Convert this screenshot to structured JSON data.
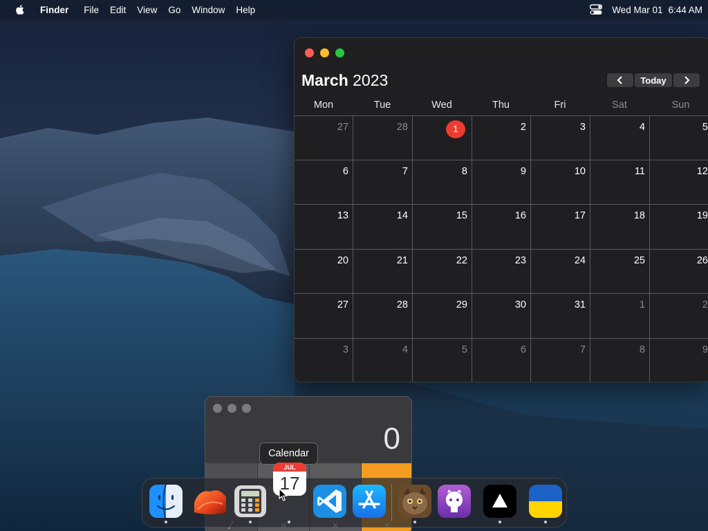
{
  "menubar": {
    "app_name": "Finder",
    "menus": [
      "File",
      "Edit",
      "View",
      "Go",
      "Window",
      "Help"
    ],
    "date": "Wed Mar 01",
    "time": "6:44 AM"
  },
  "calendar": {
    "month": "March",
    "year": "2023",
    "nav": {
      "prev_icon": "chevron-left-icon",
      "today_label": "Today",
      "next_icon": "chevron-right-icon"
    },
    "weekdays": [
      "Mon",
      "Tue",
      "Wed",
      "Thu",
      "Fri",
      "Sat",
      "Sun"
    ],
    "weeks": [
      [
        "27",
        "28",
        "1",
        "2",
        "3",
        "4",
        "5"
      ],
      [
        "6",
        "7",
        "8",
        "9",
        "10",
        "11",
        "12"
      ],
      [
        "13",
        "14",
        "15",
        "16",
        "17",
        "18",
        "19"
      ],
      [
        "20",
        "21",
        "22",
        "23",
        "24",
        "25",
        "26"
      ],
      [
        "27",
        "28",
        "29",
        "30",
        "31",
        "1",
        "2"
      ],
      [
        "3",
        "4",
        "5",
        "6",
        "7",
        "8",
        "9"
      ]
    ],
    "muted_cells": [
      "0-0",
      "0-1",
      "4-5",
      "4-6",
      "5-0",
      "5-1",
      "5-2",
      "5-3",
      "5-4",
      "5-5",
      "5-6"
    ],
    "today_cell": "0-2",
    "today_color": "#ec3b30"
  },
  "calculator": {
    "display": "0",
    "key_glyphs": [
      "⁄",
      "×",
      "×",
      "×"
    ],
    "operator_color": "#f39c1f"
  },
  "tooltip": {
    "label": "Calendar"
  },
  "calendar_dock_icon": {
    "month": "JUL",
    "day": "17"
  },
  "dock": {
    "items": [
      {
        "name": "finder",
        "icon": "finder-icon",
        "running": true
      },
      {
        "name": "wallpaper",
        "icon": "wallpaper-icon",
        "running": false
      },
      {
        "name": "calculator",
        "icon": "calculator-icon",
        "running": true
      },
      {
        "name": "calendar",
        "icon": "calendar-icon",
        "running": true
      },
      {
        "name": "vscode",
        "icon": "vscode-icon",
        "running": false
      },
      {
        "name": "app-store",
        "icon": "app-store-icon",
        "running": false
      },
      {
        "name": "cat-app",
        "icon": "cat-icon",
        "running": true
      },
      {
        "name": "github",
        "icon": "github-icon",
        "running": false
      },
      {
        "name": "vercel",
        "icon": "vercel-triangle-icon",
        "running": true
      },
      {
        "name": "ukraine-flag",
        "icon": "ukraine-flag-icon",
        "running": true
      }
    ]
  }
}
